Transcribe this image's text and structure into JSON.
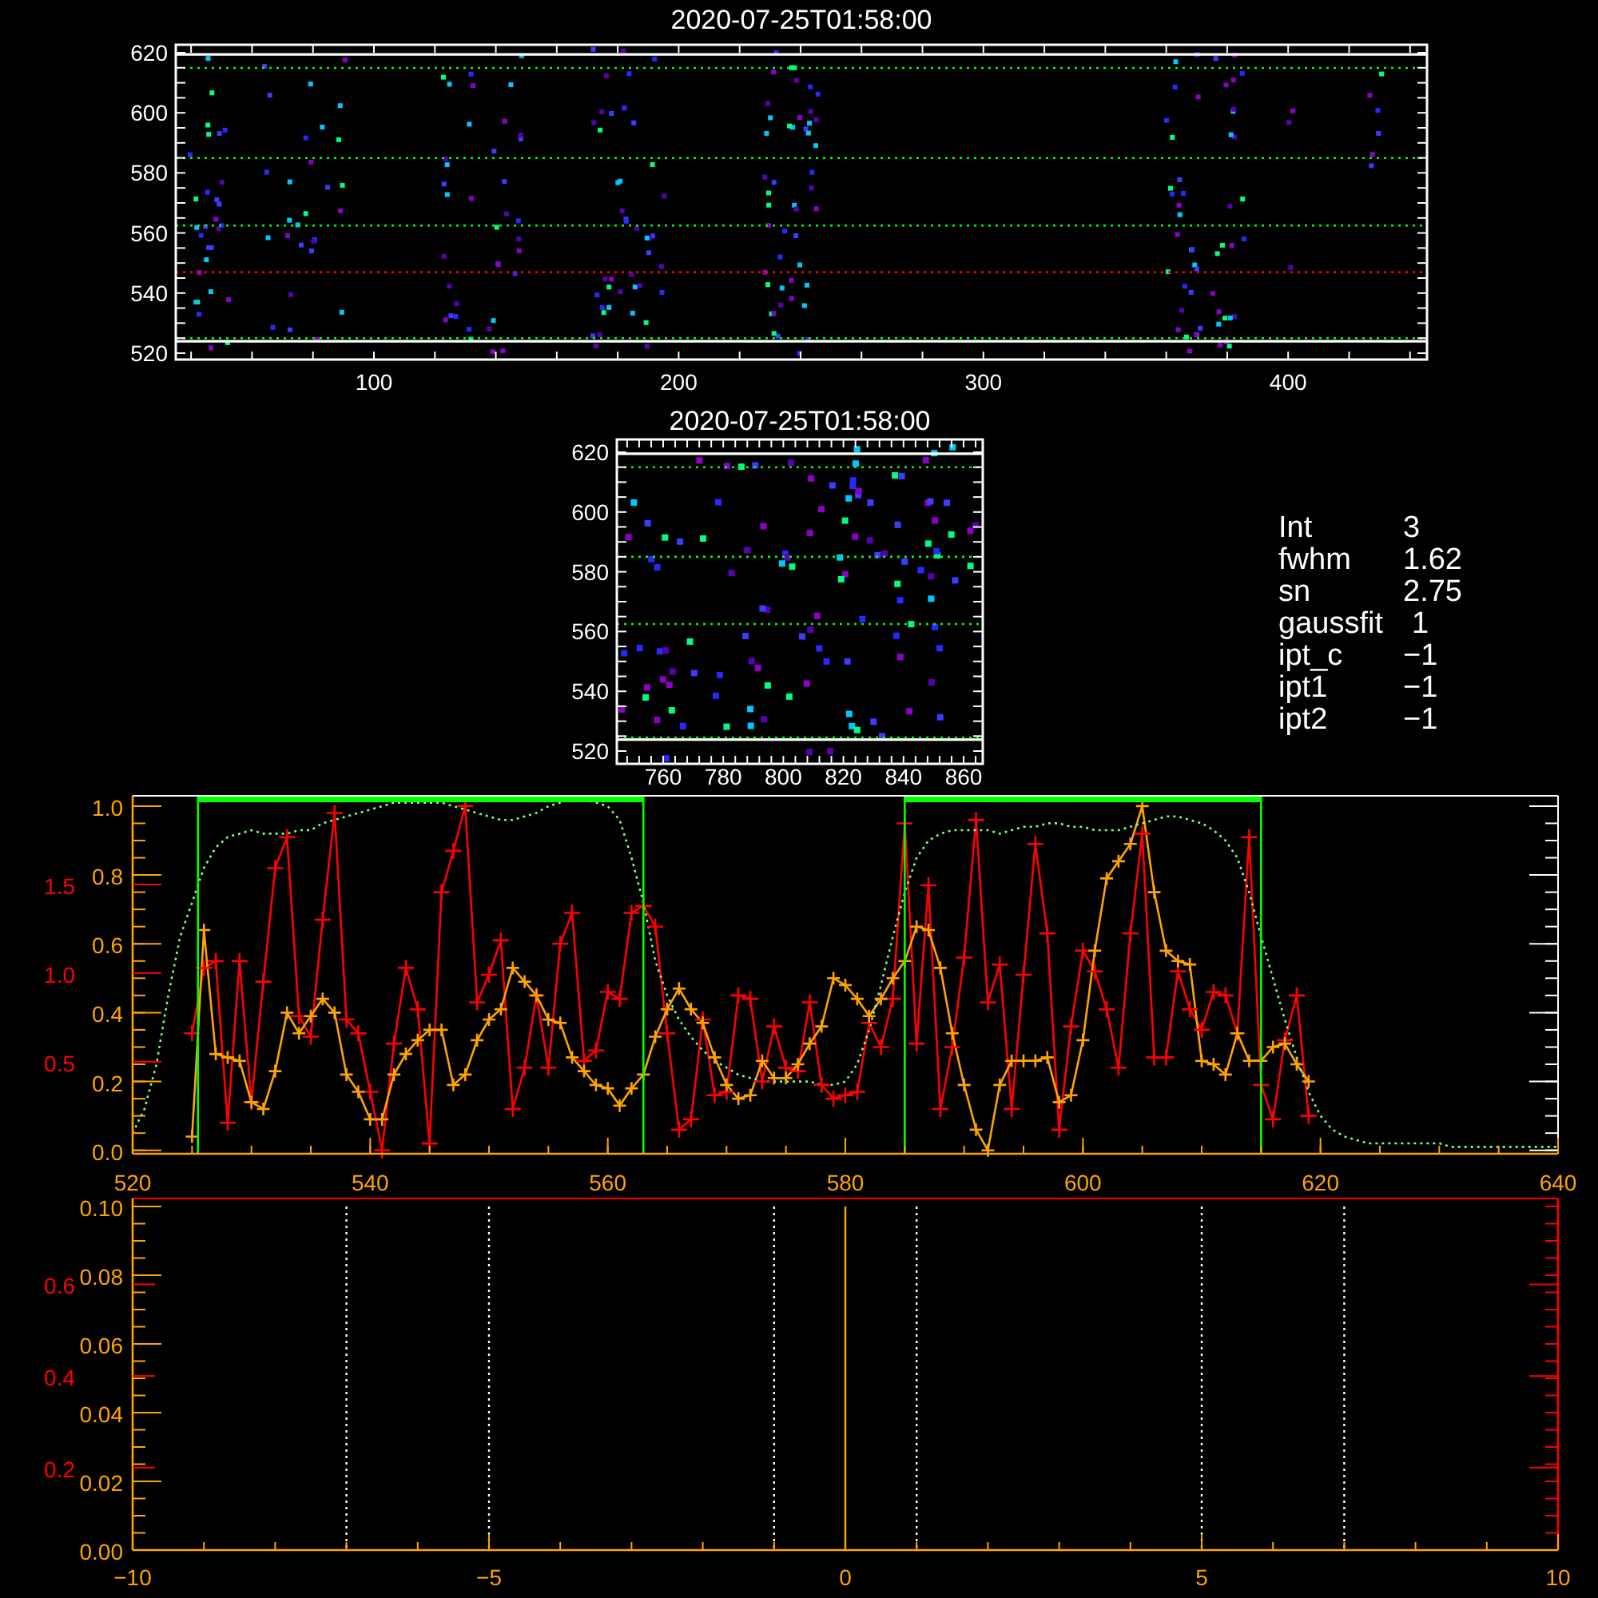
{
  "image_panels": [
    {
      "title": "2020-07-25T01:58:00",
      "xticks": [
        "100",
        "200",
        "300",
        "400"
      ],
      "yticks": [
        "620",
        "600",
        "580",
        "560",
        "540",
        "520"
      ]
    },
    {
      "title": "2020-07-25T01:58:00",
      "xticks": [
        "760",
        "780",
        "800",
        "820",
        "840",
        "860"
      ],
      "yticks": [
        "620",
        "600",
        "580",
        "560",
        "540",
        "520"
      ]
    }
  ],
  "stats": [
    {
      "label": "Int",
      "value": "3"
    },
    {
      "label": "fwhm",
      "value": "1.62"
    },
    {
      "label": "sn",
      "value": "2.75"
    },
    {
      "label": "gaussfit",
      "value": "1"
    },
    {
      "label": "ipt_c",
      "value": "−1"
    },
    {
      "label": "ipt1",
      "value": "−1"
    },
    {
      "label": "ipt2",
      "value": "−1"
    }
  ],
  "profile_plot": {
    "chart_data": {
      "type": "line",
      "xlim": [
        520,
        640
      ],
      "ylim": [
        -0.01,
        1.03
      ],
      "xticks": [
        520,
        540,
        560,
        580,
        600,
        620,
        640
      ],
      "yticks": [
        {
          "value": 0,
          "label": "0.0"
        },
        {
          "value": 0.2,
          "label": "0.2"
        },
        {
          "value": 0.4,
          "label": "0.4"
        },
        {
          "value": 0.6,
          "label": "0.6"
        },
        {
          "value": 0.8,
          "label": "0.8"
        },
        {
          "value": 1,
          "label": "1.0"
        }
      ],
      "y2lim": [
        -0.02,
        2.0
      ],
      "y2ticks": [
        {
          "value": 0.5,
          "label": "0.5"
        },
        {
          "value": 1.0,
          "label": "1.0"
        },
        {
          "value": 1.5,
          "label": "1.5"
        }
      ],
      "x": [
        520,
        521,
        522,
        523,
        524,
        525,
        526,
        527,
        528,
        529,
        530,
        531,
        532,
        533,
        534,
        535,
        536,
        537,
        538,
        539,
        540,
        541,
        542,
        543,
        544,
        545,
        546,
        547,
        548,
        549,
        550,
        551,
        552,
        553,
        554,
        555,
        556,
        557,
        558,
        559,
        560,
        561,
        562,
        563,
        564,
        565,
        566,
        567,
        568,
        569,
        570,
        571,
        572,
        573,
        574,
        575,
        576,
        577,
        578,
        579,
        580,
        581,
        582,
        583,
        584,
        585,
        586,
        587,
        588,
        589,
        590,
        591,
        592,
        593,
        594,
        595,
        596,
        597,
        598,
        599,
        600,
        601,
        602,
        603,
        604,
        605,
        606,
        607,
        608,
        609,
        610,
        611,
        612,
        613,
        614,
        615,
        616,
        617,
        618,
        619,
        620,
        621,
        622,
        623,
        624,
        625,
        626,
        627,
        628,
        629,
        630,
        631,
        632,
        633,
        634,
        635,
        636,
        637,
        638,
        639,
        640
      ],
      "series": [
        {
          "color": "#ff0000",
          "marker": "+",
          "values": [
            null,
            null,
            null,
            null,
            null,
            0.34,
            0.53,
            0.55,
            0.08,
            0.55,
            0.14,
            0.49,
            0.82,
            0.91,
            0.39,
            0.33,
            0.67,
            0.98,
            0.38,
            0.34,
            0.17,
            0,
            0.31,
            0.53,
            0.41,
            0.02,
            0.75,
            0.87,
            1.0,
            0.43,
            0.51,
            0.61,
            0.12,
            0.24,
            0.45,
            0.24,
            0.6,
            0.69,
            0.26,
            0.29,
            0.46,
            0.44,
            0.69,
            0.71,
            0.65,
            0.34,
            0.06,
            0.09,
            0.38,
            0.16,
            0.17,
            0.45,
            0.44,
            0.2,
            0.36,
            0.24,
            0.23,
            0.43,
            0.19,
            0.15,
            0.16,
            0.17,
            0.37,
            0.3,
            0.44,
            0.95,
            0.31,
            0.77,
            0.12,
            0.3,
            0.56,
            0.96,
            0.43,
            0.54,
            0.12,
            0.51,
            0.89,
            0.63,
            0.06,
            0.36,
            0.58,
            0.52,
            0.41,
            0.24,
            0.63,
            0.92,
            0.27,
            0.27,
            0.52,
            0.41,
            0.35,
            0.46,
            0.45,
            0.34,
            0.91,
            0.19,
            0.09,
            0.32,
            0.45,
            0.1,
            null,
            null,
            null,
            null,
            null,
            null,
            null,
            null,
            null,
            null,
            null,
            null,
            null,
            null,
            null,
            null,
            null,
            null,
            null,
            null,
            null
          ]
        },
        {
          "color": "#ffa500",
          "marker": "+",
          "values": [
            null,
            null,
            null,
            null,
            null,
            0.04,
            0.64,
            0.28,
            0.27,
            0.26,
            0.14,
            0.12,
            0.23,
            0.4,
            0.34,
            0.39,
            0.44,
            0.4,
            0.22,
            0.17,
            0.09,
            0.09,
            0.22,
            0.28,
            0.32,
            0.35,
            0.35,
            0.19,
            0.22,
            0.32,
            0.38,
            0.41,
            0.53,
            0.49,
            0.45,
            0.38,
            0.37,
            0.27,
            0.23,
            0.19,
            0.18,
            0.13,
            0.18,
            0.22,
            0.33,
            0.41,
            0.47,
            0.41,
            0.37,
            0.27,
            0.19,
            0.15,
            0.16,
            0.26,
            0.21,
            0.21,
            0.25,
            0.31,
            0.36,
            0.5,
            0.48,
            0.44,
            0.39,
            0.44,
            0.5,
            0.55,
            0.65,
            0.64,
            0.53,
            0.34,
            0.19,
            0.06,
            0,
            0.19,
            0.26,
            0.26,
            0.26,
            0.27,
            0.14,
            0.16,
            0.32,
            0.58,
            0.79,
            0.84,
            0.89,
            1.0,
            0.75,
            0.58,
            0.55,
            0.54,
            0.26,
            0.25,
            0.22,
            0.34,
            0.26,
            0.26,
            0.3,
            0.31,
            0.25,
            0.2,
            null,
            null,
            null,
            null,
            null,
            null,
            null,
            null,
            null,
            null,
            null,
            null,
            null,
            null,
            null,
            null,
            null,
            null,
            null,
            null,
            null
          ]
        },
        {
          "color": "#7dff7d",
          "line_style": "dotted",
          "values": [
            0.05,
            0.12,
            0.25,
            0.45,
            0.62,
            0.72,
            0.82,
            0.88,
            0.91,
            0.92,
            0.93,
            0.92,
            0.92,
            0.92,
            0.93,
            0.93,
            0.95,
            0.96,
            0.97,
            0.98,
            0.99,
            1.0,
            1.01,
            1.01,
            1.01,
            1.01,
            1.01,
            1.0,
            0.99,
            0.98,
            0.97,
            0.96,
            0.96,
            0.97,
            0.98,
            1.0,
            1.01,
            1.02,
            1.02,
            1.01,
            1.0,
            0.96,
            0.85,
            0.72,
            0.55,
            0.45,
            0.38,
            0.33,
            0.29,
            0.26,
            0.24,
            0.22,
            0.21,
            0.2,
            0.2,
            0.2,
            0.2,
            0.2,
            0.19,
            0.19,
            0.2,
            0.25,
            0.35,
            0.48,
            0.62,
            0.75,
            0.85,
            0.9,
            0.92,
            0.93,
            0.93,
            0.93,
            0.93,
            0.92,
            0.93,
            0.94,
            0.94,
            0.95,
            0.95,
            0.94,
            0.94,
            0.93,
            0.93,
            0.93,
            0.94,
            0.95,
            0.96,
            0.97,
            0.97,
            0.96,
            0.95,
            0.93,
            0.9,
            0.85,
            0.75,
            0.62,
            0.5,
            0.38,
            0.27,
            0.17,
            0.1,
            0.06,
            0.04,
            0.03,
            0.02,
            0.02,
            0.02,
            0.02,
            0.02,
            0.02,
            0.02,
            0.01,
            0.01,
            0.01,
            0.01,
            0.01,
            0.01,
            0.01,
            0.01,
            0.01,
            0.01
          ]
        }
      ],
      "ref_lines": [
        {
          "axis": "x",
          "value": 525.5,
          "color": "#00ff00"
        },
        {
          "axis": "x",
          "value": 563,
          "color": "#00ff00"
        },
        {
          "axis": "x",
          "value": 585,
          "color": "#00ff00"
        },
        {
          "axis": "x",
          "value": 615,
          "color": "#00ff00"
        }
      ]
    }
  },
  "offset_plot": {
    "chart_data": {
      "type": "line",
      "xlim": [
        -10,
        10
      ],
      "ylim": [
        0,
        0.1
      ],
      "xticks": [
        {
          "value": -10,
          "label": "−10"
        },
        {
          "value": -5,
          "label": "−5"
        },
        {
          "value": 0,
          "label": "0"
        },
        {
          "value": 5,
          "label": "5"
        },
        {
          "value": 10,
          "label": "10"
        }
      ],
      "yticks": [
        {
          "value": 0,
          "label": "0.00"
        },
        {
          "value": 0.02,
          "label": "0.02"
        },
        {
          "value": 0.04,
          "label": "0.04"
        },
        {
          "value": 0.06,
          "label": "0.06"
        },
        {
          "value": 0.08,
          "label": "0.08"
        },
        {
          "value": 0.1,
          "label": "0.10"
        }
      ],
      "y2lim": [
        0.02,
        0.77
      ],
      "y2ticks": [
        0.2,
        0.4,
        0.6
      ],
      "ref_lines": [
        {
          "axis": "x",
          "value": -7,
          "color": "#ffffff",
          "line_style": "dotted"
        },
        {
          "axis": "x",
          "value": -5,
          "color": "#ffffff",
          "line_style": "dotted"
        },
        {
          "axis": "x",
          "value": -1,
          "color": "#ffffff",
          "line_style": "dotted"
        },
        {
          "axis": "x",
          "value": 0,
          "color": "#ffa500",
          "line_style": "solid"
        },
        {
          "axis": "x",
          "value": 1,
          "color": "#ffffff",
          "line_style": "dotted"
        },
        {
          "axis": "x",
          "value": 5,
          "color": "#ffffff",
          "line_style": "dotted"
        },
        {
          "axis": "x",
          "value": 7,
          "color": "#ffffff",
          "line_style": "dotted"
        }
      ]
    }
  }
}
